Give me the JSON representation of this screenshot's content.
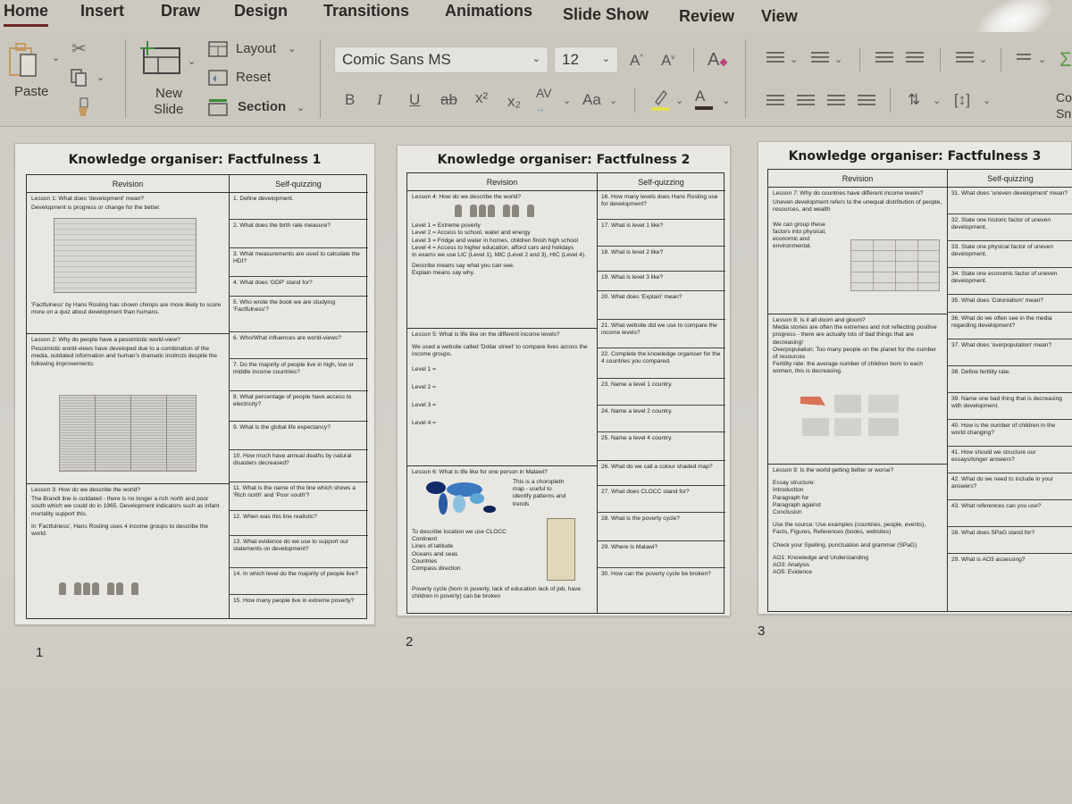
{
  "tabs": [
    {
      "label": "Home",
      "active": true
    },
    {
      "label": "Insert"
    },
    {
      "label": "Draw"
    },
    {
      "label": "Design"
    },
    {
      "label": "Transitions"
    },
    {
      "label": "Animations"
    },
    {
      "label": "Slide Show"
    },
    {
      "label": "Review"
    },
    {
      "label": "View"
    }
  ],
  "ribbon": {
    "paste_label": "Paste",
    "new_slide_label_1": "New",
    "new_slide_label_2": "Slide",
    "layout_label": "Layout",
    "reset_label": "Reset",
    "section_label": "Section",
    "font_name": "Comic Sans MS",
    "font_size": "12",
    "bold": "B",
    "italic": "I",
    "underline": "U",
    "strike": "ab",
    "superscript": "x²",
    "subscript": "x₂",
    "char_spacing": "AV",
    "change_case": "Aa",
    "grow_font": "A",
    "shrink_font": "A",
    "font_color": "A",
    "convert_smartart_1": "Co",
    "convert_smartart_2": "Sn",
    "highlight_color": "#e4e052",
    "font_color_bar": "#3a2e2a",
    "accent_color": "#6b2a24"
  },
  "slides": [
    {
      "number": "1",
      "title": "Knowledge organiser: Factfulness 1",
      "revision_header": "Revision",
      "quiz_header": "Self-quizzing",
      "lessons": [
        {
          "lines": [
            "Lesson 1: What does 'development' mean?",
            "Development is progress or change for the better.",
            "'Factfulness' by Hans Rosling has shown chimps are more likely to score more on a quiz about development than humans."
          ],
          "image": "How can we measure development? (table)"
        },
        {
          "lines": [
            "Lesson 2: Why do people have a pessimistic world-view?",
            "Pessimistic world-views have developed due to a combination of the media, outdated information and human's dramatic instincts despite the following improvements:"
          ],
          "image": "improvements panels"
        },
        {
          "lines": [
            "Lesson 3: How do we describe the world?",
            "The Brandt line is outdated - there is no longer a rich north and poor south which we could do in 1965. Development indicators such as infant mortality support this.",
            "In 'Factfulness', Hans Rosling uses 4 income groups to describe the world:"
          ],
          "image": "income groups figures"
        }
      ],
      "questions": [
        "1. Define development.",
        "2. What does the birth rate measure?",
        "3. What measurements are used to calculate the HDI?",
        "4. What does 'GDP' stand for?",
        "5. Who wrote the book we are studying 'Factfulness'?",
        "6. Who/What influences are world-views?",
        "7. Do the majority of people live in high, low or middle income countries?",
        "8. What percentage of people have access to electricity?",
        "9. What is the global life expectancy?",
        "10. How much have annual deaths by natural disasters decreased?",
        "11. What is the name of the line which shows a 'Rich north' and 'Poor south'?",
        "12. When was this line realistic?",
        "13. What evidence do we use to support our statements on development?",
        "14. In which level do the majority of people live?",
        "15. How many people live in extreme poverty?"
      ]
    },
    {
      "number": "2",
      "title": "Knowledge organiser: Factfulness 2",
      "revision_header": "Revision",
      "quiz_header": "Self-quizzing",
      "lessons": [
        {
          "lines": [
            "Lesson 4: How do we describe the world?",
            "Level 1 = Extreme poverty",
            "Level 2 = Access to school, water and energy",
            "Level 3 = Fridge and water in homes, children finish high school",
            "Level 4 = Access to higher education, afford cars and holidays",
            "In exams we use LIC (Level 1), MIC (Level 2 and 3), HIC (Level 4).",
            "Describe means say what you can see.",
            "Explain means say why."
          ]
        },
        {
          "lines": [
            "Lesson 5: What is life like on the different income levels?",
            "We used a website called 'Dollar street' to compare lives across the income groups.",
            "Level 1 =",
            "Level 2 =",
            "Level 3 =",
            "Level 4 ="
          ]
        },
        {
          "lines": [
            "Lesson 6: What is life like for one person in Malawi?",
            "This is a choropleth map - useful to identify patterns and trends",
            "To describe location we use CLOCC",
            "Continent",
            "Lines of latitude",
            "Oceans and seas",
            "Countries",
            "Compass direction",
            "Poverty cycle (born in poverty, lack of education lack of job, have children in poverty) can be broken"
          ]
        }
      ],
      "questions": [
        "16. How many levels does Hans Rosling use for development?",
        "17. What is level 1 like?",
        "18. What is level 2 like?",
        "19. What is level 3 like?",
        "20. What does 'Explain' mean?",
        "21. What website did we use to compare the income levels?",
        "22. Complete the knowledge organiser for the 4 countries you compared.",
        "23. Name a level 1 country.",
        "24. Name a level 2 country.",
        "25. Name a level 4 country.",
        "26. What do we call a colour shaded map?",
        "27. What does CLOCC stand for?",
        "28. What is the poverty cycle?",
        "29. Where is Malawi?",
        "30. How can the poverty cycle be broken?"
      ]
    },
    {
      "number": "3",
      "title": "Knowledge organiser: Factfulness 3",
      "revision_header": "Revision",
      "quiz_header": "Self-quizzing",
      "lessons": [
        {
          "lines": [
            "Lesson 7: Why do countries have different income levels?",
            "Uneven development refers to the unequal distribution of people, resources, and wealth",
            "We can group these factors into physical, economic and environmental."
          ]
        },
        {
          "lines": [
            "Lesson 8: Is it all doom and gloom?",
            "Media stories are often the extremes and not reflecting positive progress - there are actually lots of bad things that are decreasing!",
            "Overpopulation: Too many people on the planet for the number of resources",
            "Fertility rate: the average number of children born to each women, this is decreasing."
          ]
        },
        {
          "lines": [
            "Lesson 9: Is the world getting better or worse?",
            "Essay structure:",
            "Introduction",
            "Paragraph for",
            "Paragraph against",
            "Conclusion",
            "Use the source: Use examples (countries, people, events), Facts, Figures, References (books, websites)",
            "Check your Spelling, punctuation and grammar (SPaG)",
            "AO1: Knowledge and Understanding",
            "AO3: Analysis",
            "AO5: Evidence"
          ]
        }
      ],
      "questions": [
        "31. What does 'uneven development' mean?",
        "32. State one historic factor of uneven development.",
        "33. State one physical factor of uneven development.",
        "34. State one economic factor of uneven development.",
        "35. What does 'Colonialism' mean?",
        "36. What do we often see in the media regarding development?",
        "37. What does 'overpopulation' mean?",
        "38. Define fertility rate.",
        "39. Name one bad thing that is decreasing with development.",
        "40. How is the number of children in the world changing?",
        "41. How should we structure our essays/longer answers?",
        "42. What do we need to include in your answers?",
        "43. What references can you use?",
        "28. What does SPaG stand for?",
        "29. What is AO3 assessing?"
      ]
    }
  ]
}
